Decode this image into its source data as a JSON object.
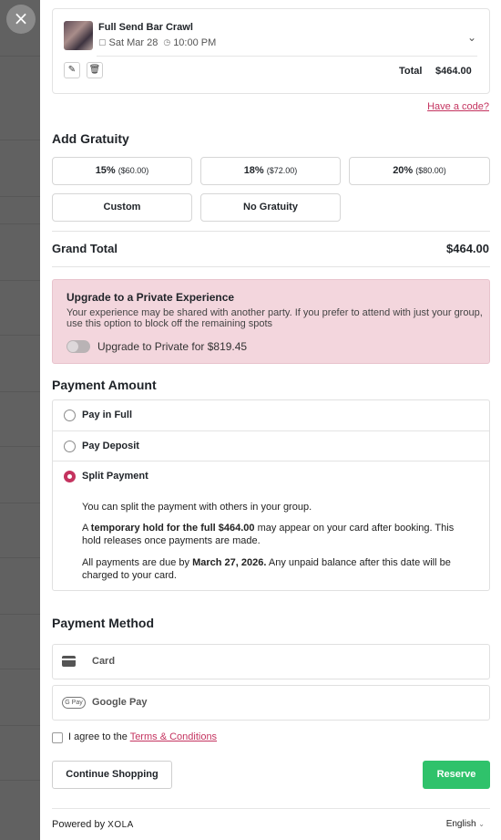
{
  "modal": {
    "close_glyph": "×"
  },
  "event": {
    "title": "Full Send Bar Crawl",
    "date": "Sat Mar 28",
    "time": "10:00 PM",
    "total_label": "Total",
    "total_value": "$464.00",
    "chevron_glyph": "⌄",
    "edit_glyph": "✎",
    "delete_glyph": "🗑",
    "calendar_glyph": "▢",
    "clock_glyph": "◷"
  },
  "promo": {
    "link_text": "Have a code?"
  },
  "gratuity": {
    "title": "Add Gratuity",
    "options": [
      {
        "label": "15%",
        "sub": "($60.00)"
      },
      {
        "label": "18%",
        "sub": "($72.00)"
      },
      {
        "label": "20%",
        "sub": "($80.00)"
      },
      {
        "label": "Custom",
        "sub": ""
      },
      {
        "label": "No Gratuity",
        "sub": ""
      }
    ]
  },
  "grand_total": {
    "label": "Grand Total",
    "value": "$464.00"
  },
  "upgrade": {
    "title": "Upgrade to a Private Experience",
    "description": "Your experience may be shared with another party. If you prefer to attend with just your group, use this option to block off the remaining spots",
    "toggle_label": "Upgrade to Private for $819.45",
    "toggle_on": false
  },
  "payment_amount": {
    "title": "Payment Amount",
    "options": [
      {
        "label": "Pay in Full",
        "selected": false
      },
      {
        "label": "Pay Deposit",
        "selected": false
      },
      {
        "label": "Split Payment",
        "selected": true
      }
    ],
    "split_line1": "You can split the payment with others in your group.",
    "split_line2_pre": "A ",
    "split_line2_bold": "temporary hold for the full $464.00",
    "split_line2_post": " may appear on your card after booking. This hold releases once payments are made.",
    "split_line3_pre": "All payments are due by ",
    "split_line3_bold": "March 27, 2026.",
    "split_line3_post": " Any unpaid balance after this date will be charged to your card."
  },
  "payment_method": {
    "title": "Payment Method",
    "options": [
      {
        "label": "Card",
        "icon": "credit-card-icon"
      },
      {
        "label": "Google Pay",
        "icon": "google-pay-icon",
        "icon_text": "G Pay"
      }
    ]
  },
  "terms": {
    "pre": "I agree to the ",
    "link": "Terms & Conditions",
    "checked": false
  },
  "actions": {
    "continue": "Continue Shopping",
    "reserve": "Reserve"
  },
  "footer": {
    "powered_by": "Powered by",
    "brand": "XOLA",
    "language": "English",
    "caret": "⌄"
  },
  "colors": {
    "accent": "#c4335f",
    "reserve": "#2fc26b",
    "upgrade_bg": "#f3d6dd"
  }
}
